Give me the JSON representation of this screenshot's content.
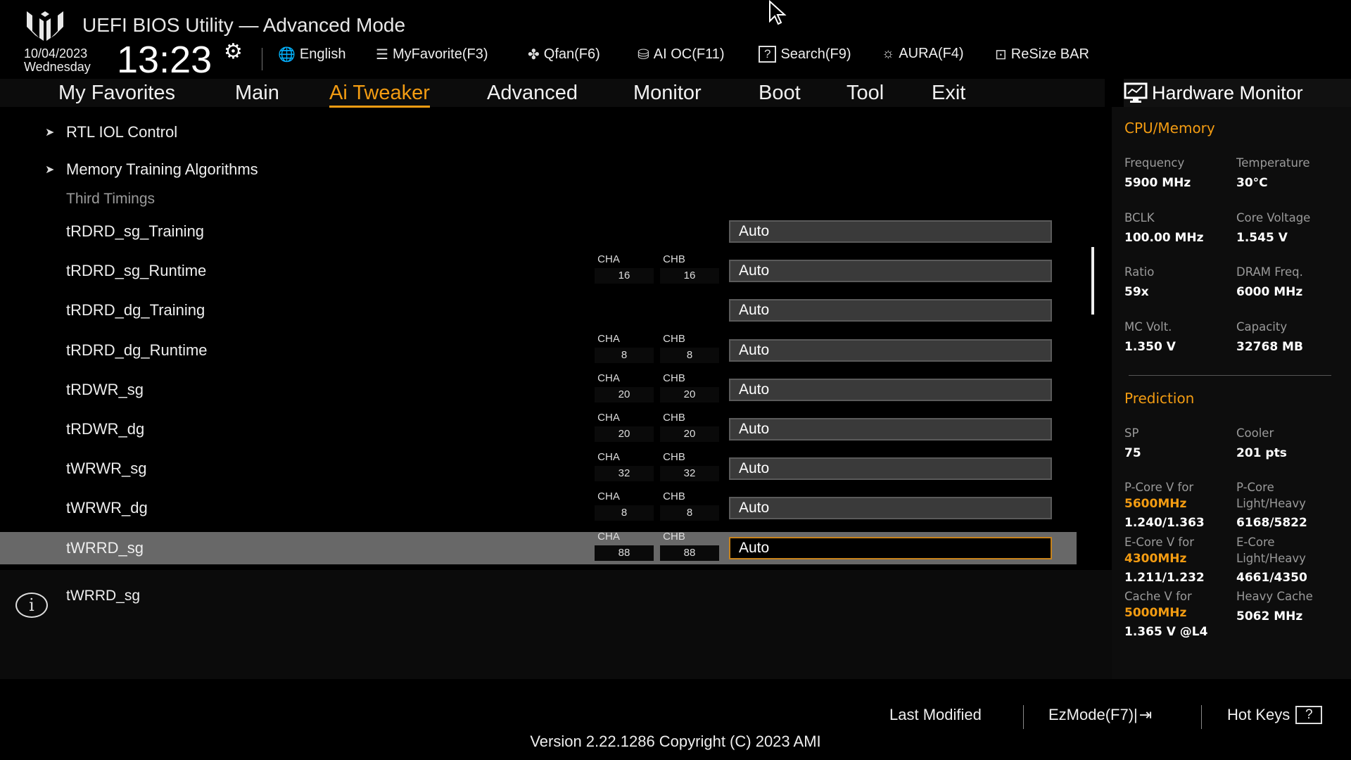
{
  "header": {
    "title": "UEFI BIOS Utility — Advanced Mode",
    "date": "10/04/2023",
    "day": "Wednesday",
    "time": "13:23"
  },
  "toolbar": [
    {
      "label": "English",
      "icon": "globe-icon",
      "glyph": "🌐"
    },
    {
      "label": "MyFavorite(F3)",
      "icon": "favorite-list-icon",
      "glyph": "☰"
    },
    {
      "label": "Qfan(F6)",
      "icon": "fan-icon",
      "glyph": "✤"
    },
    {
      "label": "AI OC(F11)",
      "icon": "ai-chip-icon",
      "glyph": "⛁"
    },
    {
      "label": "Search(F9)",
      "icon": "search-help-icon",
      "glyph": "?"
    },
    {
      "label": "AURA(F4)",
      "icon": "aura-light-icon",
      "glyph": "☼"
    },
    {
      "label": "ReSize BAR",
      "icon": "resize-bar-icon",
      "glyph": "⊡"
    }
  ],
  "tabs": [
    "My Favorites",
    "Main",
    "Ai Tweaker",
    "Advanced",
    "Monitor",
    "Boot",
    "Tool",
    "Exit"
  ],
  "active_tab": "Ai Tweaker",
  "menu": {
    "submenus": [
      "RTL IOL Control",
      "Memory Training Algorithms"
    ],
    "section": "Third Timings"
  },
  "rows": [
    {
      "label": "tRDRD_sg_Training",
      "value": "Auto"
    },
    {
      "label": "tRDRD_sg_Runtime",
      "cha": "16",
      "chb": "16",
      "value": "Auto"
    },
    {
      "label": "tRDRD_dg_Training",
      "value": "Auto"
    },
    {
      "label": "tRDRD_dg_Runtime",
      "cha": "8",
      "chb": "8",
      "value": "Auto"
    },
    {
      "label": "tRDWR_sg",
      "cha": "20",
      "chb": "20",
      "value": "Auto"
    },
    {
      "label": "tRDWR_dg",
      "cha": "20",
      "chb": "20",
      "value": "Auto"
    },
    {
      "label": "tWRWR_sg",
      "cha": "32",
      "chb": "32",
      "value": "Auto"
    },
    {
      "label": "tWRWR_dg",
      "cha": "8",
      "chb": "8",
      "value": "Auto"
    },
    {
      "label": "tWRRD_sg",
      "cha": "88",
      "chb": "88",
      "value": "Auto",
      "selected": true
    }
  ],
  "channel_labels": {
    "a": "CHA",
    "b": "CHB"
  },
  "help": {
    "text": "tWRRD_sg"
  },
  "hw": {
    "title": "Hardware Monitor",
    "cpu_title": "CPU/Memory",
    "cpu": [
      [
        "Frequency",
        "5900 MHz",
        "Temperature",
        "30°C"
      ],
      [
        "BCLK",
        "100.00 MHz",
        "Core Voltage",
        "1.545 V"
      ],
      [
        "Ratio",
        "59x",
        "DRAM Freq.",
        "6000 MHz"
      ],
      [
        "MC Volt.",
        "1.350 V",
        "Capacity",
        "32768 MB"
      ]
    ],
    "pred_title": "Prediction",
    "sp_label": "SP",
    "sp": "75",
    "cooler_label": "Cooler",
    "cooler": "201 pts",
    "pcore_label": "P-Core V for",
    "pcore_freq": "5600MHz",
    "pcore_v": "1.240/1.363",
    "pcore_lh_label1": "P-Core",
    "pcore_lh_label2": "Light/Heavy",
    "pcore_lh": "6168/5822",
    "ecore_label": "E-Core V for",
    "ecore_freq": "4300MHz",
    "ecore_v": "1.211/1.232",
    "ecore_lh_label1": "E-Core",
    "ecore_lh_label2": "Light/Heavy",
    "ecore_lh": "4661/4350",
    "cache_label": "Cache V for",
    "cache_freq": "5000MHz",
    "cache_v": "1.365 V @L4",
    "heavy_cache_label": "Heavy Cache",
    "heavy_cache": "5062 MHz"
  },
  "footer": {
    "last_modified": "Last Modified",
    "ezmode": "EzMode(F7)|",
    "hotkeys": "Hot Keys",
    "version": "Version 2.22.1286 Copyright (C) 2023 AMI"
  },
  "colors": {
    "accent": "#f39c12",
    "selected_row": "#686868"
  }
}
